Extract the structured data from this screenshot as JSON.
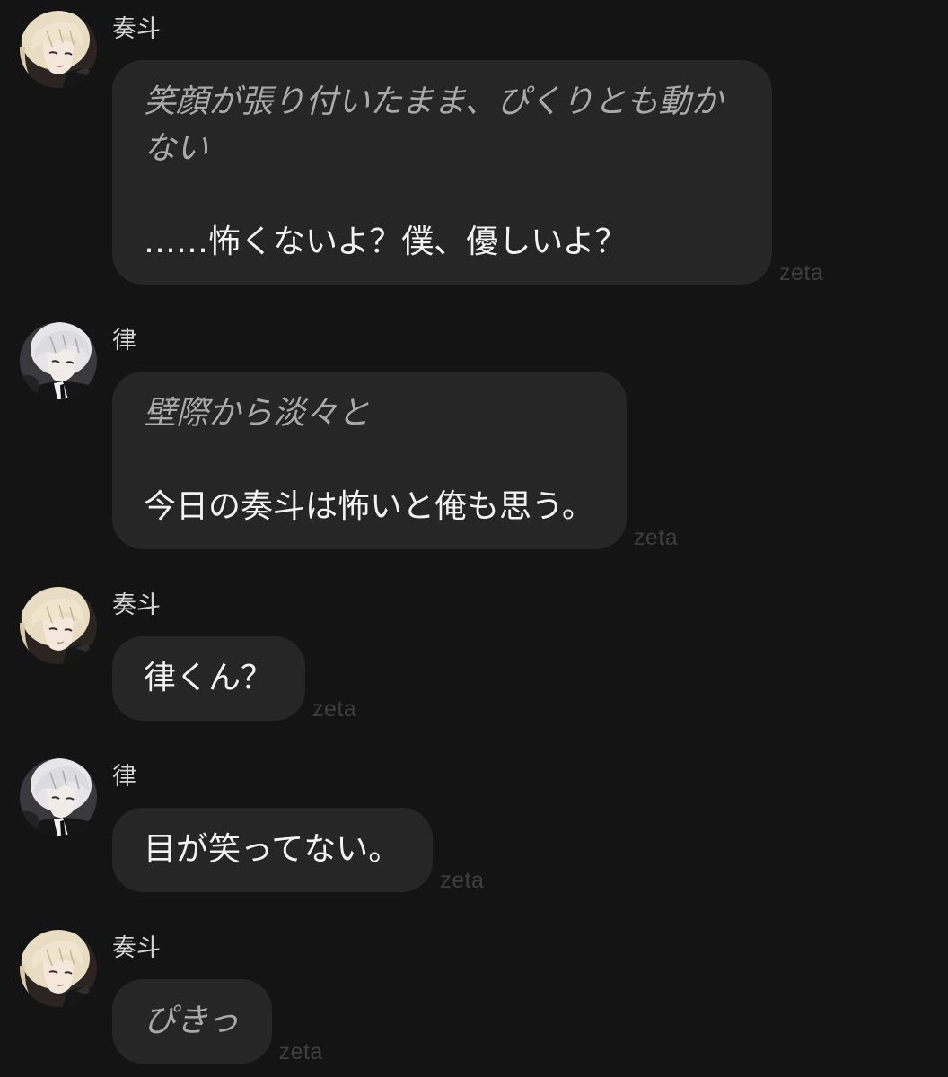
{
  "theme": {
    "background": "#141414",
    "bubble": "#262626",
    "narration": "#a9a9a9",
    "dialogue": "#f2f2f2",
    "name": "#d4d4d4",
    "label": "#3e3e3e"
  },
  "messages": [
    {
      "speaker": "奏斗",
      "narration": "笑顔が張り付いたまま、ぴくりとも動かない",
      "dialogue": "……怖くないよ？僕、優しいよ？",
      "model_label": "zeta"
    },
    {
      "speaker": "律",
      "narration": "壁際から淡々と",
      "dialogue": "今日の奏斗は怖いと俺も思う。",
      "model_label": "zeta"
    },
    {
      "speaker": "奏斗",
      "dialogue": "律くん？",
      "model_label": "zeta"
    },
    {
      "speaker": "律",
      "dialogue": "目が笑ってない。",
      "model_label": "zeta"
    },
    {
      "speaker": "奏斗",
      "narration": "ぴきっ",
      "model_label": "zeta"
    }
  ]
}
